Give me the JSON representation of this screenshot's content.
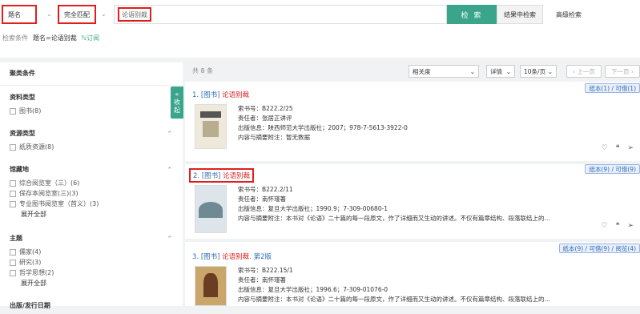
{
  "search": {
    "field": "题名",
    "match": "完全匹配",
    "query": "论语别裁",
    "search_btn": "检 索",
    "in_results_btn": "结果中检索",
    "advanced": "高级检索"
  },
  "conditions": {
    "label": "检索条件",
    "value": "题名=论语别裁",
    "subscribe": "订阅"
  },
  "facets": {
    "title": "聚类条件",
    "collapse_label": [
      "«",
      "收",
      "起"
    ],
    "groups": [
      {
        "title": "资料类型",
        "items": [
          "图书(8)"
        ]
      },
      {
        "title": "资源类型",
        "items": [
          "纸质资源(8)"
        ]
      },
      {
        "title": "馆藏地",
        "items": [
          "综合阅览室（三）(6)",
          "保存本阅览室(三)(3)",
          "专业图书阅览室（首义）(3)"
        ],
        "more": "展开全部"
      },
      {
        "title": "主题",
        "items": [
          "儒家(4)",
          "研究(3)",
          "哲学思想(2)"
        ],
        "more": "展开全部"
      },
      {
        "title": "出版/发行日期"
      }
    ]
  },
  "results": {
    "total": "共 8 条",
    "sort": "相关度",
    "view": "详情",
    "per_page": "10条/页",
    "prev": "上一页",
    "next": "下一页",
    "items": [
      {
        "num": "1.",
        "type": "[图书]",
        "title": "论语别裁",
        "suffix": "",
        "call_no": "索书号：B222.2/25",
        "author": "责任者：张居正讲评",
        "publish": "出版信息：陕西师范大学出版社；2007；978-7-5613-3922-0",
        "abstract": "内容与摘要附注：暂无数据",
        "badge": "纸本(1) / 可借(1)"
      },
      {
        "num": "2.",
        "type": "[图书]",
        "title": "论语别裁",
        "suffix": "",
        "call_no": "索书号：B222.2/11",
        "author": "责任者：南怀瑾著",
        "publish": "出版信息：复旦大学出版社；1990.9；7-309-00680-1",
        "abstract": "内容与摘要附注：本书对《论语》二十篇的每一段原文，作了详细而又生动的讲述。不仅有篇章结构、段落联结上的...",
        "badge": "纸本(9) / 可借(9)"
      },
      {
        "num": "3.",
        "type": "[图书]",
        "title": "论语别裁",
        "suffix": ". 第2版",
        "call_no": "索书号：B222.15/1",
        "author": "责任者：南怀瑾著",
        "publish": "出版信息：复旦大学出版社；1996.6；7-309-01076-0",
        "abstract": "内容与摘要附注：本书对《论语》二十篇的每一段原文，作了详细而又生动的讲述。不仅有篇章结构、段落联结上的...",
        "badge": "纸本(9) / 可借(9) / 阅览(4)"
      }
    ]
  },
  "colors": {
    "accent": "#3aa58a",
    "highlight": "#e01e1e",
    "link": "#2e6eb5"
  }
}
